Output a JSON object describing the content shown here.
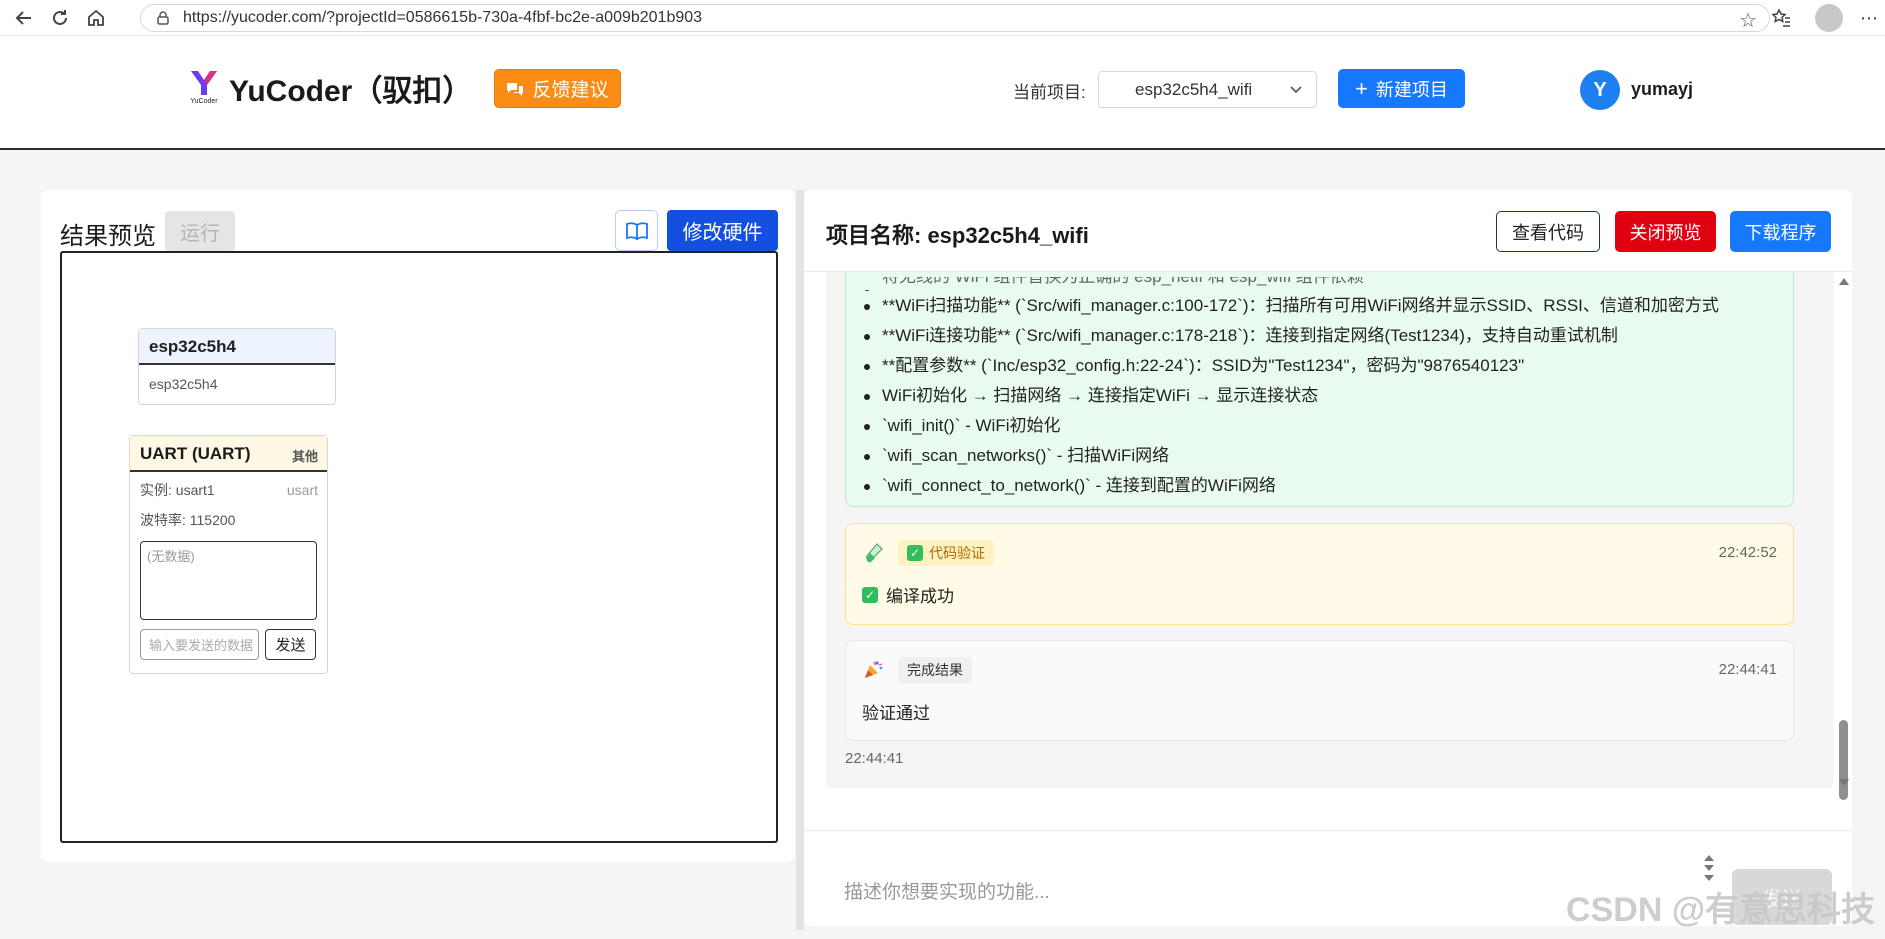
{
  "browser": {
    "url": "https://yucoder.com/?projectId=0586615b-730a-4fbf-bc2e-a009b201b903"
  },
  "header": {
    "logo_text": "YuCoder（驭扣）",
    "logo_small": "YuCoder",
    "feedback_label": "反馈建议",
    "current_project_label": "当前项目:",
    "current_project_value": "esp32c5h4_wifi",
    "new_project_label": "新建项目",
    "avatar_letter": "Y",
    "username": "yumayj"
  },
  "left": {
    "title": "结果预览",
    "run_label": "运行",
    "modify_label": "修改硬件",
    "chip": {
      "title": "esp32c5h4",
      "subtitle": "esp32c5h4"
    },
    "uart": {
      "title": "UART (UART)",
      "tag": "其他",
      "instance": "实例: usart1",
      "instance_type": "usart",
      "baud": "波特率: 115200",
      "empty": "(无数据)",
      "input_placeholder": "输入要发送的数据",
      "send_label": "发送"
    }
  },
  "right": {
    "project_name": "项目名称: esp32c5h4_wifi",
    "view_code_label": "查看代码",
    "close_preview_label": "关闭预览",
    "download_label": "下载程序",
    "summary_items": [
      "将无线的 WiFi 组件替换为正确的 esp_netif 和 esp_wifi 组件依赖",
      "**WiFi扫描功能** (`Src/wifi_manager.c:100-172`)：扫描所有可用WiFi网络并显示SSID、RSSI、信道和加密方式",
      "**WiFi连接功能** (`Src/wifi_manager.c:178-218`)：连接到指定网络(Test1234)，支持自动重试机制",
      "**配置参数** (`Inc/esp32_config.h:22-24`)：SSID为\"Test1234\"，密码为\"9876540123\"",
      "WiFi初始化 → 扫描网络 → 连接指定WiFi → 显示连接状态",
      "`wifi_init()` - WiFi初始化",
      "`wifi_scan_networks()` - 扫描WiFi网络",
      "`wifi_connect_to_network()` - 连接到配置的WiFi网络"
    ],
    "verify": {
      "tag": "代码验证",
      "time": "22:42:52",
      "body": "编译成功"
    },
    "result": {
      "tag": "完成结果",
      "time": "22:44:41",
      "body": "验证通过"
    },
    "footer_time": "22:44:41",
    "input_placeholder": "描述你想要实现的功能...",
    "send_label": "发送"
  },
  "watermark": "CSDN @有意思科技",
  "colors": {
    "feedback": "#fa8c16",
    "primary": "#1677ff",
    "danger": "#e00010",
    "modify": "#1350e0"
  }
}
